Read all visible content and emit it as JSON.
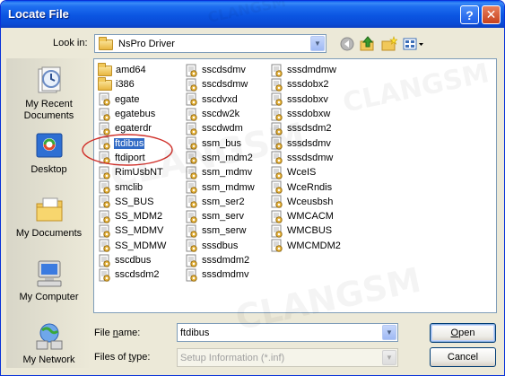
{
  "window": {
    "title": "Locate File",
    "help_label": "?",
    "close_label": "✕"
  },
  "lookin": {
    "label": "Look in:",
    "value": "NsPro Driver"
  },
  "toolbar": {
    "icons": [
      "back-icon",
      "up-folder-icon",
      "new-folder-icon",
      "view-menu-icon"
    ]
  },
  "places": [
    {
      "label": "My Recent Documents",
      "icon": "recent-documents-icon"
    },
    {
      "label": "Desktop",
      "icon": "desktop-icon"
    },
    {
      "label": "My Documents",
      "icon": "my-documents-icon"
    },
    {
      "label": "My Computer",
      "icon": "my-computer-icon"
    },
    {
      "label": "My Network",
      "icon": "my-network-icon"
    }
  ],
  "files": {
    "col1": [
      {
        "name": "amd64",
        "kind": "folder"
      },
      {
        "name": "i386",
        "kind": "folder"
      },
      {
        "name": "egate",
        "kind": "sys"
      },
      {
        "name": "egatebus",
        "kind": "sys"
      },
      {
        "name": "egaterdr",
        "kind": "sys"
      },
      {
        "name": "ftdibus",
        "kind": "sys",
        "selected": true
      },
      {
        "name": "ftdiport",
        "kind": "sys"
      },
      {
        "name": "RimUsbNT",
        "kind": "sys"
      },
      {
        "name": "smclib",
        "kind": "sys"
      },
      {
        "name": "SS_BUS",
        "kind": "sys"
      },
      {
        "name": "SS_MDM2",
        "kind": "sys"
      },
      {
        "name": "SS_MDMV",
        "kind": "sys"
      },
      {
        "name": "SS_MDMW",
        "kind": "sys"
      },
      {
        "name": "sscdbus",
        "kind": "sys"
      },
      {
        "name": "sscdsdm2",
        "kind": "sys"
      }
    ],
    "col2": [
      {
        "name": "sscdsdmv",
        "kind": "sys"
      },
      {
        "name": "sscdsdmw",
        "kind": "sys"
      },
      {
        "name": "sscdvxd",
        "kind": "sys"
      },
      {
        "name": "sscdw2k",
        "kind": "sys"
      },
      {
        "name": "sscdwdm",
        "kind": "sys"
      },
      {
        "name": "ssm_bus",
        "kind": "sys"
      },
      {
        "name": "ssm_mdm2",
        "kind": "sys"
      },
      {
        "name": "ssm_mdmv",
        "kind": "sys"
      },
      {
        "name": "ssm_mdmw",
        "kind": "sys"
      },
      {
        "name": "ssm_ser2",
        "kind": "sys"
      },
      {
        "name": "ssm_serv",
        "kind": "sys"
      },
      {
        "name": "ssm_serw",
        "kind": "sys"
      },
      {
        "name": "sssdbus",
        "kind": "sys"
      },
      {
        "name": "sssdmdm2",
        "kind": "sys"
      },
      {
        "name": "sssdmdmv",
        "kind": "sys"
      }
    ],
    "col3": [
      {
        "name": "sssdmdmw",
        "kind": "sys"
      },
      {
        "name": "sssdobx2",
        "kind": "sys"
      },
      {
        "name": "sssdobxv",
        "kind": "sys"
      },
      {
        "name": "sssdobxw",
        "kind": "sys"
      },
      {
        "name": "sssdsdm2",
        "kind": "sys"
      },
      {
        "name": "sssdsdmv",
        "kind": "sys"
      },
      {
        "name": "sssdsdmw",
        "kind": "sys"
      },
      {
        "name": "WceIS",
        "kind": "sys"
      },
      {
        "name": "WceRndis",
        "kind": "sys"
      },
      {
        "name": "Wceusbsh",
        "kind": "sys"
      },
      {
        "name": "WMCACM",
        "kind": "sys"
      },
      {
        "name": "WMCBUS",
        "kind": "sys"
      },
      {
        "name": "WMCMDM2",
        "kind": "sys"
      }
    ]
  },
  "filename": {
    "label_pre": "File ",
    "label_u": "n",
    "label_post": "ame:",
    "value": "ftdibus"
  },
  "filetype": {
    "label_pre": "Files of ",
    "label_u": "t",
    "label_post": "ype:",
    "value": "Setup Information (*.inf)"
  },
  "buttons": {
    "open_u": "O",
    "open_rest": "pen",
    "cancel": "Cancel"
  },
  "watermark": "CLANGSM",
  "colors": {
    "titlebar": "#0b55e2",
    "selection": "#316ac5",
    "annotation_ring": "#d0302a"
  }
}
